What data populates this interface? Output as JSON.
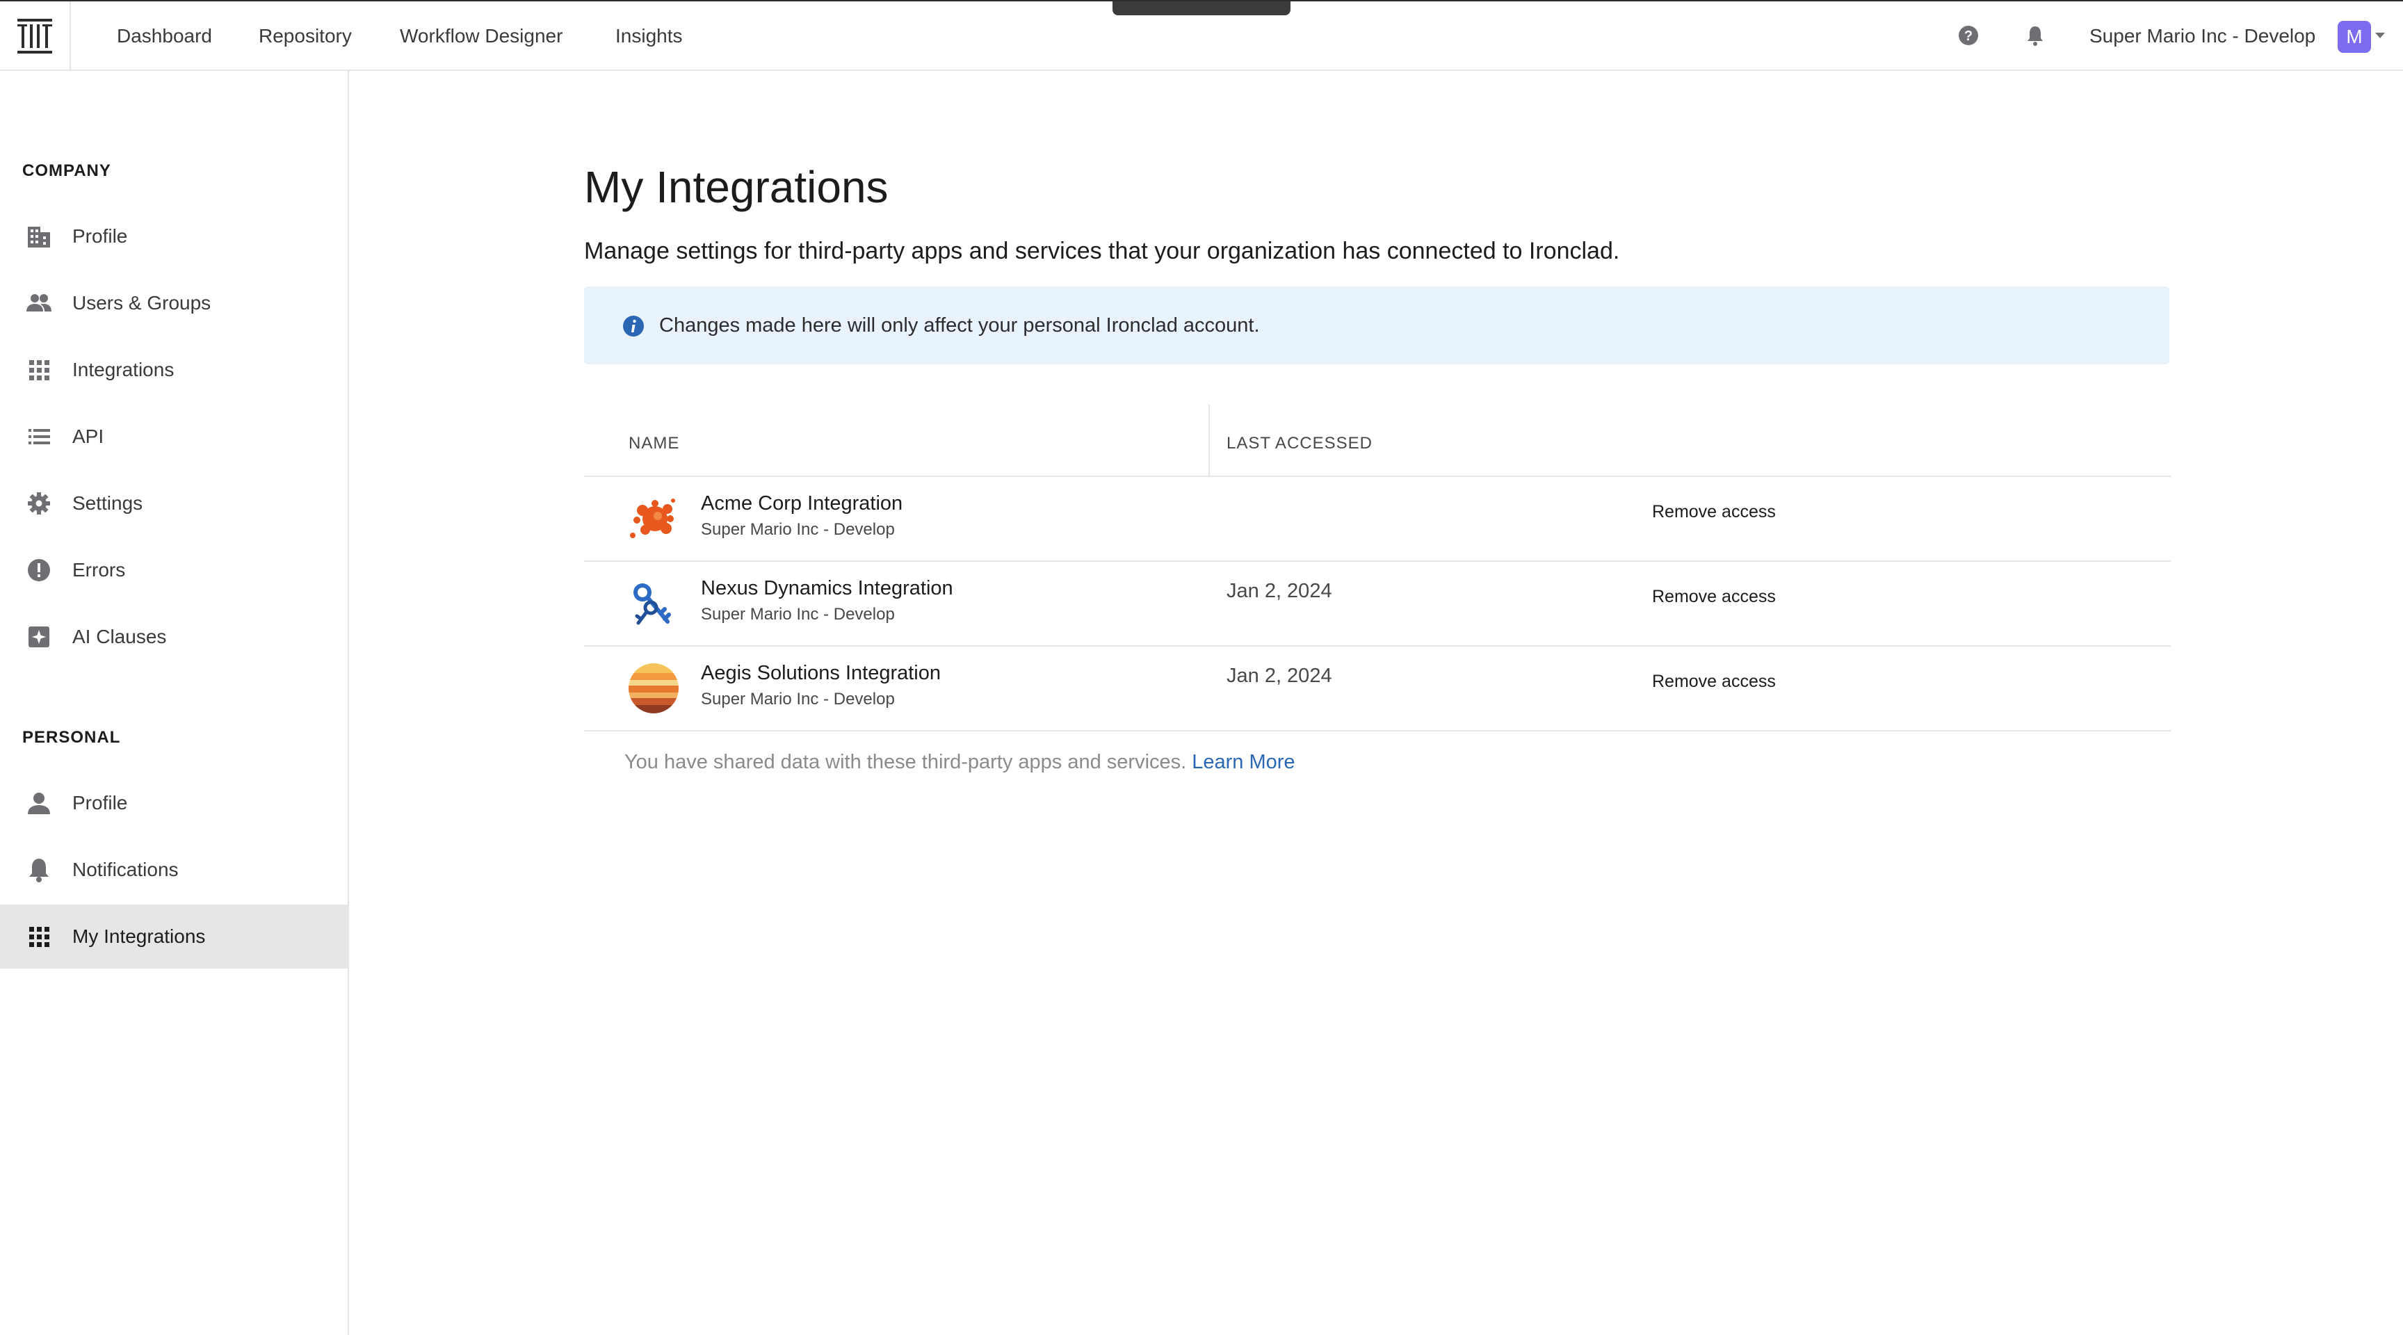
{
  "nav": {
    "links": [
      "Dashboard",
      "Repository",
      "Workflow Designer",
      "Insights"
    ],
    "org_name": "Super Mario Inc - Develop",
    "avatar_initial": "M"
  },
  "sidebar": {
    "company_title": "COMPANY",
    "company_items": [
      "Profile",
      "Users & Groups",
      "Integrations",
      "API",
      "Settings",
      "Errors",
      "AI Clauses"
    ],
    "personal_title": "PERSONAL",
    "personal_items": [
      "Profile",
      "Notifications",
      "My Integrations"
    ]
  },
  "main": {
    "title": "My Integrations",
    "subtitle": "Manage settings for third-party apps and services that your organization has connected to Ironclad.",
    "banner": "Changes made here will only affect your personal Ironclad account."
  },
  "table": {
    "headers": {
      "name": "NAME",
      "last_accessed": "LAST ACCESSED"
    },
    "rows": [
      {
        "name": "Acme Corp Integration",
        "org": "Super Mario Inc - Develop",
        "last_accessed": "",
        "action": "Remove access",
        "logo": "orange-splash-logo"
      },
      {
        "name": "Nexus Dynamics Integration",
        "org": "Super Mario Inc - Develop",
        "last_accessed": "Jan 2, 2024",
        "action": "Remove access",
        "logo": "blue-keys-logo"
      },
      {
        "name": "Aegis Solutions Integration",
        "org": "Super Mario Inc - Develop",
        "last_accessed": "Jan 2, 2024",
        "action": "Remove access",
        "logo": "sunset-sphere-logo"
      }
    ]
  },
  "footer": {
    "note": "You have shared data with these third-party apps and services.",
    "link": "Learn More"
  },
  "colors": {
    "accent": "#2a66b4",
    "avatar": "#7b6cf0",
    "banner_bg": "#e8f3fc",
    "active_item_bg": "#e6e6e8"
  }
}
